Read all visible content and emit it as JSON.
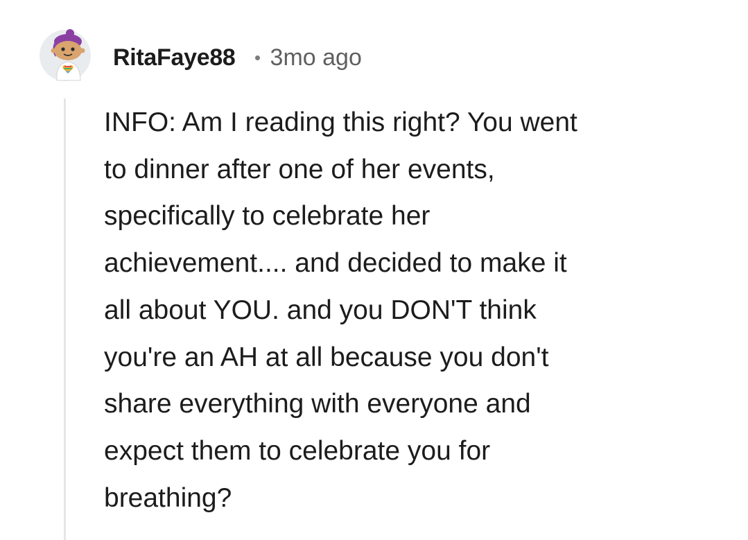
{
  "comment": {
    "author": "RitaFaye88",
    "age": "3mo ago",
    "avatar_icon": "snoo-avatar-icon",
    "body_lines": [
      "INFO: Am I reading this right? You went",
      "to dinner after one of her events,",
      "specifically to celebrate her",
      "achievement.... and decided to make it",
      "all about YOU. and you DON'T think",
      "you're an AH at all because you don't",
      "share everything with everyone and",
      "expect them to celebrate you for",
      "breathing?"
    ]
  },
  "colors": {
    "text": "#1c1c1c",
    "meta": "#5f5f5f",
    "thread_line": "#e4e6e8",
    "avatar_bg": "#e9ecef",
    "hair": "#8a3fa3"
  }
}
